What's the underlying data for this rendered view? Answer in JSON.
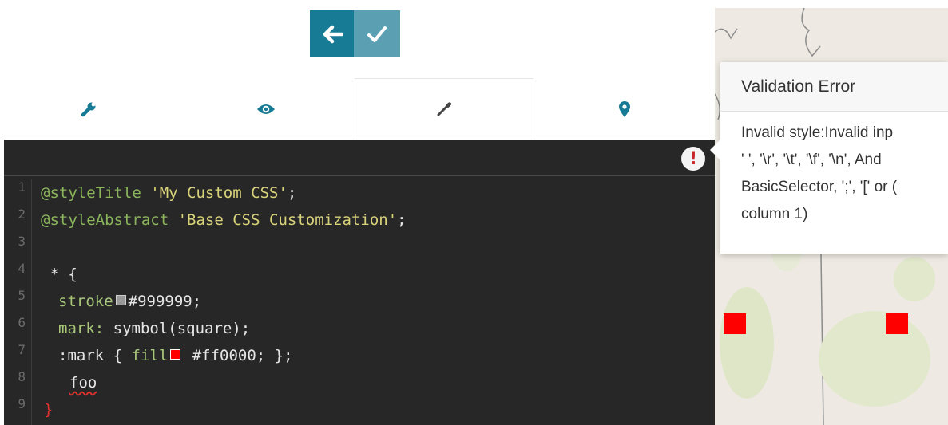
{
  "toolbar": {
    "back_icon": "arrow-left-icon",
    "confirm_icon": "check-icon",
    "accent": "#177b95",
    "accent_light": "#5b9fb3"
  },
  "tabs": [
    {
      "icon": "wrench-icon",
      "active": false
    },
    {
      "icon": "eye-icon",
      "active": false
    },
    {
      "icon": "eyedropper-icon",
      "active": true
    },
    {
      "icon": "map-pin-icon",
      "active": false
    }
  ],
  "editor": {
    "error_marker": "!",
    "line_numbers": [
      "1",
      "2",
      "3",
      "4",
      "5",
      "6",
      "7",
      "8",
      "9"
    ],
    "lines": {
      "l1_kw": "@styleTitle",
      "l1_str": "'My Custom CSS'",
      "l1_end": ";",
      "l2_kw": "@styleAbstract",
      "l2_str": "'Base CSS Customization'",
      "l2_end": ";",
      "l4": " * {",
      "l5_prop": "stroke",
      "l5_val": "#999999;",
      "l6_prop": "mark:",
      "l6_val": " symbol(square);",
      "l7_a": ":mark { ",
      "l7_prop": "fill",
      "l7_val": " #ff0000; };",
      "l8": "foo",
      "l9": "}"
    },
    "swatch_colors": {
      "stroke": "#999999",
      "fill": "#ff0000"
    }
  },
  "popover": {
    "title": "Validation Error",
    "body_lines": [
      "Invalid style:Invalid inp",
      "' ', '\\r', '\\t', '\\f', '\\n', And",
      "BasicSelector, ';', '[' or (",
      "column 1)"
    ]
  },
  "map": {
    "marker_color": "#ff0000"
  }
}
